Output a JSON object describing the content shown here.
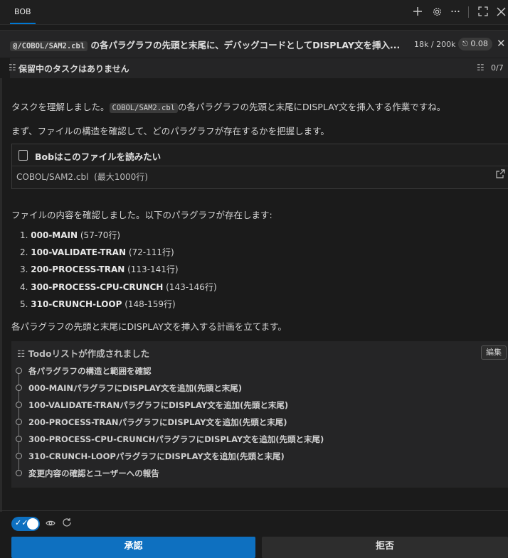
{
  "topbar": {
    "tab_label": "BOB",
    "icons": [
      "plus-icon",
      "gear-icon",
      "more-icon",
      "fullscreen-icon",
      "close-icon"
    ]
  },
  "task": {
    "mention": "@/COBOL/SAM2.cbl",
    "title_rest": "の各パラグラフの先頭と末尾に、デバッグコードとしてDISPLAY文を挿入...",
    "tokens": "18k / 200k",
    "cost": "0.08"
  },
  "pending": {
    "label": "保留中のタスクはありません",
    "count": "0/7"
  },
  "messages": {
    "m1_pre": "タスクを理解しました。",
    "m1_code": "COBOL/SAM2.cbl",
    "m1_post": "の各パラグラフの先頭と末尾にDISPLAY文を挿入する作業ですね。",
    "m2": "まず、ファイルの構造を確認して、どのパラグラフが存在するかを把握します。",
    "m3": "ファイルの内容を確認しました。以下のパラグラフが存在します:",
    "m4": "各パラグラフの先頭と末尾にDISPLAY文を挿入する計画を立てます。"
  },
  "file_read": {
    "header": "Bobはこのファイルを読みたい",
    "path": "COBOL/SAM2.cbl",
    "limit": "(最大1000行)"
  },
  "paragraphs": [
    {
      "num": "1.",
      "name": "000-MAIN",
      "range": "(57-70行)"
    },
    {
      "num": "2.",
      "name": "100-VALIDATE-TRAN",
      "range": "(72-111行)"
    },
    {
      "num": "3.",
      "name": "200-PROCESS-TRAN",
      "range": "(113-141行)"
    },
    {
      "num": "4.",
      "name": "300-PROCESS-CPU-CRUNCH",
      "range": "(143-146行)"
    },
    {
      "num": "5.",
      "name": "310-CRUNCH-LOOP",
      "range": "(148-159行)"
    }
  ],
  "todo": {
    "header": "Todoリストが作成されました",
    "edit_label": "編集",
    "items": [
      "各パラグラフの構造と範囲を確認",
      "000-MAINパラグラフにDISPLAY文を追加(先頭と末尾)",
      "100-VALIDATE-TRANパラグラフにDISPLAY文を追加(先頭と末尾)",
      "200-PROCESS-TRANパラグラフにDISPLAY文を追加(先頭と末尾)",
      "300-PROCESS-CPU-CRUNCHパラグラフにDISPLAY文を追加(先頭と末尾)",
      "310-CRUNCH-LOOPパラグラフにDISPLAY文を追加(先頭と末尾)",
      "変更内容の確認とユーザーへの報告"
    ]
  },
  "actions": {
    "approve": "承認",
    "reject": "拒否"
  },
  "colors": {
    "accent": "#0e70c0",
    "background": "#1b1b1b"
  }
}
